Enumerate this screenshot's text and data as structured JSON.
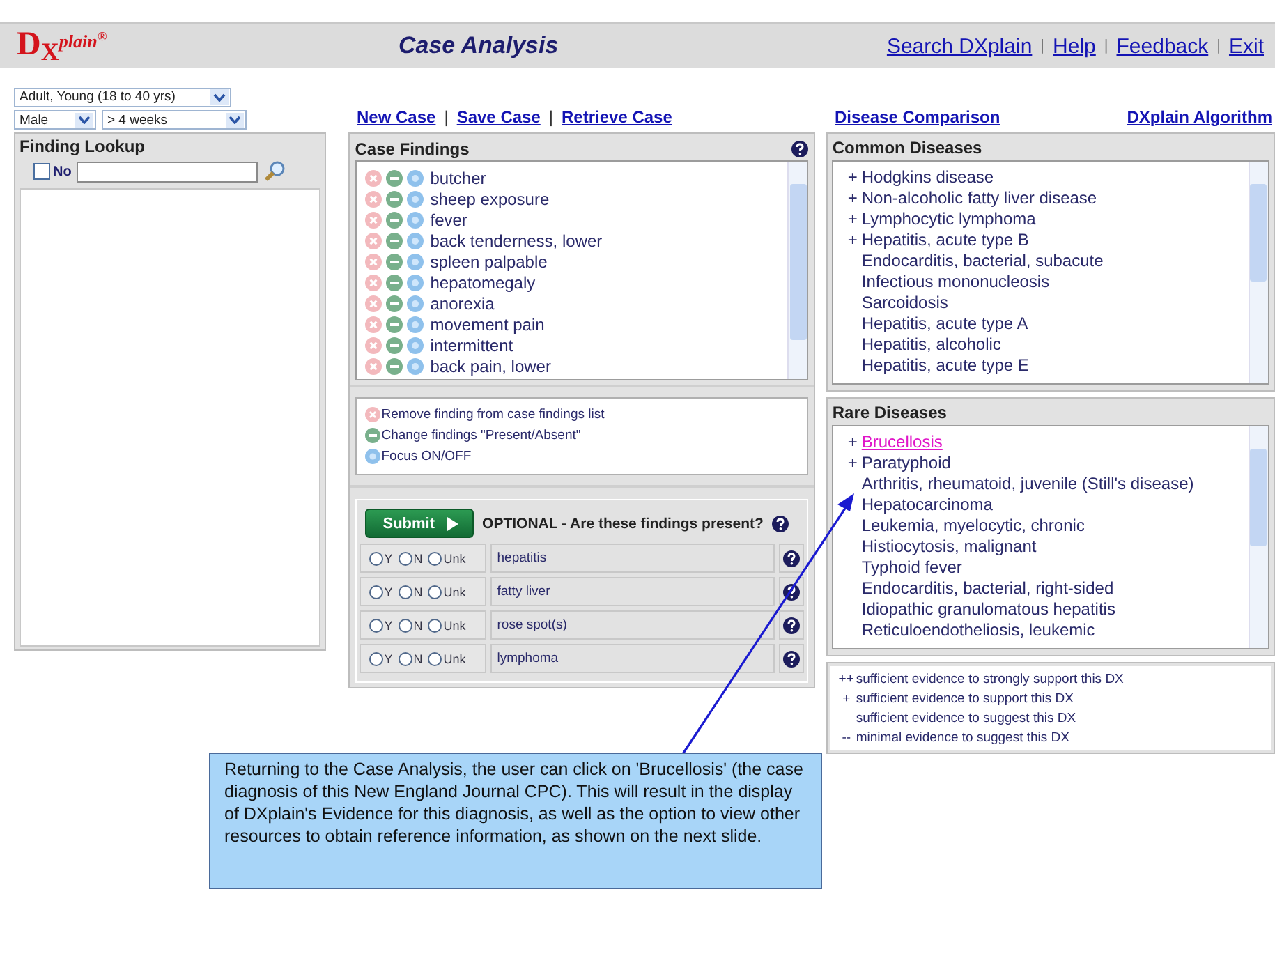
{
  "header": {
    "logo": {
      "letter": "D",
      "sub": "X",
      "rest": "plain",
      "mark": "®"
    },
    "title": "Case Analysis",
    "links": [
      "Search DXplain",
      "Help",
      "Feedback",
      "Exit"
    ],
    "link_separator": "|"
  },
  "patient": {
    "age": "Adult, Young (18 to 40 yrs)",
    "sex": "Male",
    "duration": "> 4 weeks"
  },
  "case_links": [
    "New Case",
    "Save Case",
    "Retrieve Case"
  ],
  "case_link_separator": "|",
  "comparison_link": "Disease Comparison",
  "algorithm_link": "DXplain Algorithm",
  "finding_lookup": {
    "title": "Finding Lookup",
    "no_checkbox": {
      "label": "No",
      "checked": false
    }
  },
  "case_findings": {
    "title": "Case Findings",
    "items": [
      "butcher",
      "sheep exposure",
      "fever",
      "back tenderness, lower",
      "spleen palpable",
      "hepatomegaly",
      "anorexia",
      "movement pain",
      "intermittent",
      "back pain, lower"
    ]
  },
  "findings_legend": [
    {
      "kind": "remove",
      "text": "Remove finding from case findings list"
    },
    {
      "kind": "change",
      "text": "Change findings \"Present/Absent\""
    },
    {
      "kind": "focus",
      "text": "Focus ON/OFF"
    }
  ],
  "optional": {
    "submit": "Submit",
    "prompt": "OPTIONAL - Are these findings present?",
    "rows": [
      {
        "finding": "hepatitis",
        "options": [
          {
            "label": "Y",
            "selected": false
          },
          {
            "label": "N",
            "selected": false
          },
          {
            "label": "Unk",
            "selected": false
          }
        ]
      },
      {
        "finding": "fatty liver",
        "options": [
          {
            "label": "Y",
            "selected": false
          },
          {
            "label": "N",
            "selected": false
          },
          {
            "label": "Unk",
            "selected": false
          }
        ]
      },
      {
        "finding": "rose spot(s)",
        "options": [
          {
            "label": "Y",
            "selected": false
          },
          {
            "label": "N",
            "selected": false
          },
          {
            "label": "Unk",
            "selected": false
          }
        ]
      },
      {
        "finding": "lymphoma",
        "options": [
          {
            "label": "Y",
            "selected": false
          },
          {
            "label": "N",
            "selected": false
          },
          {
            "label": "Unk",
            "selected": false
          }
        ]
      }
    ]
  },
  "common_diseases": {
    "title": "Common Diseases",
    "items": [
      {
        "marker": "+",
        "name": "Hodgkins disease",
        "hovered": false
      },
      {
        "marker": "+",
        "name": "Non-alcoholic fatty liver disease",
        "hovered": false
      },
      {
        "marker": "+",
        "name": "Lymphocytic lymphoma",
        "hovered": false
      },
      {
        "marker": "+",
        "name": "Hepatitis, acute type B",
        "hovered": false
      },
      {
        "name": "Endocarditis, bacterial, subacute",
        "hovered": false
      },
      {
        "name": "Infectious mononucleosis",
        "hovered": false
      },
      {
        "name": "Sarcoidosis",
        "hovered": false
      },
      {
        "name": "Hepatitis, acute type A",
        "hovered": false
      },
      {
        "name": "Hepatitis, alcoholic",
        "hovered": false
      },
      {
        "name": "Hepatitis, acute type E",
        "hovered": false
      }
    ]
  },
  "rare_diseases": {
    "title": "Rare Diseases",
    "items": [
      {
        "marker": "+",
        "name": "Brucellosis",
        "hovered": true
      },
      {
        "marker": "+",
        "name": "Paratyphoid",
        "hovered": false
      },
      {
        "name": "Arthritis, rheumatoid, juvenile (Still's disease)",
        "hovered": false
      },
      {
        "name": "Hepatocarcinoma",
        "hovered": false
      },
      {
        "name": "Leukemia, myelocytic, chronic",
        "hovered": false
      },
      {
        "name": "Histiocytosis, malignant",
        "hovered": false
      },
      {
        "name": "Typhoid fever",
        "hovered": false
      },
      {
        "name": "Endocarditis, bacterial, right-sided",
        "hovered": false
      },
      {
        "name": "Idiopathic granulomatous hepatitis",
        "hovered": false
      },
      {
        "name": "Reticuloendotheliosis, leukemic",
        "hovered": false
      }
    ]
  },
  "evidence_legend": [
    {
      "marker": "++",
      "text": "sufficient evidence to strongly support this DX"
    },
    {
      "marker": "+",
      "text": "sufficient evidence to support this DX"
    },
    {
      "text": "sufficient evidence to suggest this DX"
    },
    {
      "marker": "--",
      "text": "minimal evidence to suggest this DX"
    }
  ],
  "callout": "Returning to the Case Analysis, the user can click on 'Brucellosis' (the case diagnosis of this New England Journal CPC). This will result in the display of DXplain's Evidence for this diagnosis, as well as the option to view other resources to obtain reference information, as shown on the next slide."
}
